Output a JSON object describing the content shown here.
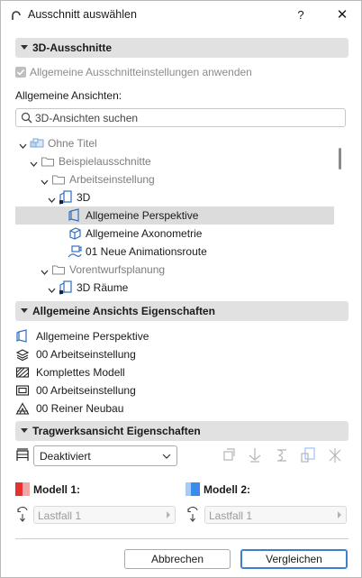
{
  "window": {
    "title": "Ausschnitt auswählen",
    "help": "?",
    "close": "✕"
  },
  "section_3d": {
    "title": "3D-Ausschnitte",
    "apply_checkbox": "Allgemeine Ausschnitteinstellungen anwenden",
    "views_label": "Allgemeine Ansichten:",
    "search_placeholder": "3D-Ansichten suchen"
  },
  "tree": [
    {
      "label": "Ohne Titel",
      "icon": "project-icon",
      "level": 0,
      "expanded": true,
      "muted": true
    },
    {
      "label": "Beispielausschnitte",
      "icon": "folder-icon",
      "level": 1,
      "expanded": true,
      "muted": true
    },
    {
      "label": "Arbeitseinstellung",
      "icon": "folder-icon",
      "level": 2,
      "expanded": true,
      "muted": true
    },
    {
      "label": "3D",
      "icon": "3d-view-icon",
      "level": 3,
      "expanded": true,
      "muted": false
    },
    {
      "label": "Allgemeine Perspektive",
      "icon": "perspective-icon",
      "level": 4,
      "selected": true,
      "muted": false
    },
    {
      "label": "Allgemeine Axonometrie",
      "icon": "axonometry-icon",
      "level": 4,
      "muted": false
    },
    {
      "label": "01 Neue Animationsroute",
      "icon": "camera-path-icon",
      "level": 4,
      "muted": false
    },
    {
      "label": "Vorentwurfsplanung",
      "icon": "folder-icon",
      "level": 2,
      "expanded": true,
      "muted": true
    },
    {
      "label": "3D Räume",
      "icon": "3d-view-icon",
      "level": 3,
      "expanded": true,
      "muted": false
    }
  ],
  "section_props": {
    "title": "Allgemeine Ansichts Eigenschaften",
    "items": [
      {
        "icon": "perspective-icon",
        "label": "Allgemeine Perspektive"
      },
      {
        "icon": "layers-icon",
        "label": "00 Arbeitseinstellung"
      },
      {
        "icon": "model-filter-icon",
        "label": "Komplettes Modell"
      },
      {
        "icon": "view-settings-icon",
        "label": "00 Arbeitseinstellung"
      },
      {
        "icon": "renovation-icon",
        "label": "00 Reiner Neubau"
      }
    ]
  },
  "section_struct": {
    "title": "Tragwerksansicht Eigenschaften",
    "mode_value": "Deaktiviert",
    "tools": [
      "node-icon",
      "support-icon",
      "spring-icon",
      "member-icon",
      "load-icon"
    ],
    "model1": {
      "label": "Modell 1:",
      "color": "#e5312f",
      "loadcase": "Lastfall 1"
    },
    "model2": {
      "label": "Modell 2:",
      "color": "#3b8be8",
      "loadcase": "Lastfall 1"
    }
  },
  "footer": {
    "cancel": "Abbrechen",
    "compare": "Vergleichen"
  },
  "colors": {
    "accent": "#3a7fd0",
    "section_bg": "#e1e1e1",
    "selection_bg": "#dcdcdc"
  }
}
